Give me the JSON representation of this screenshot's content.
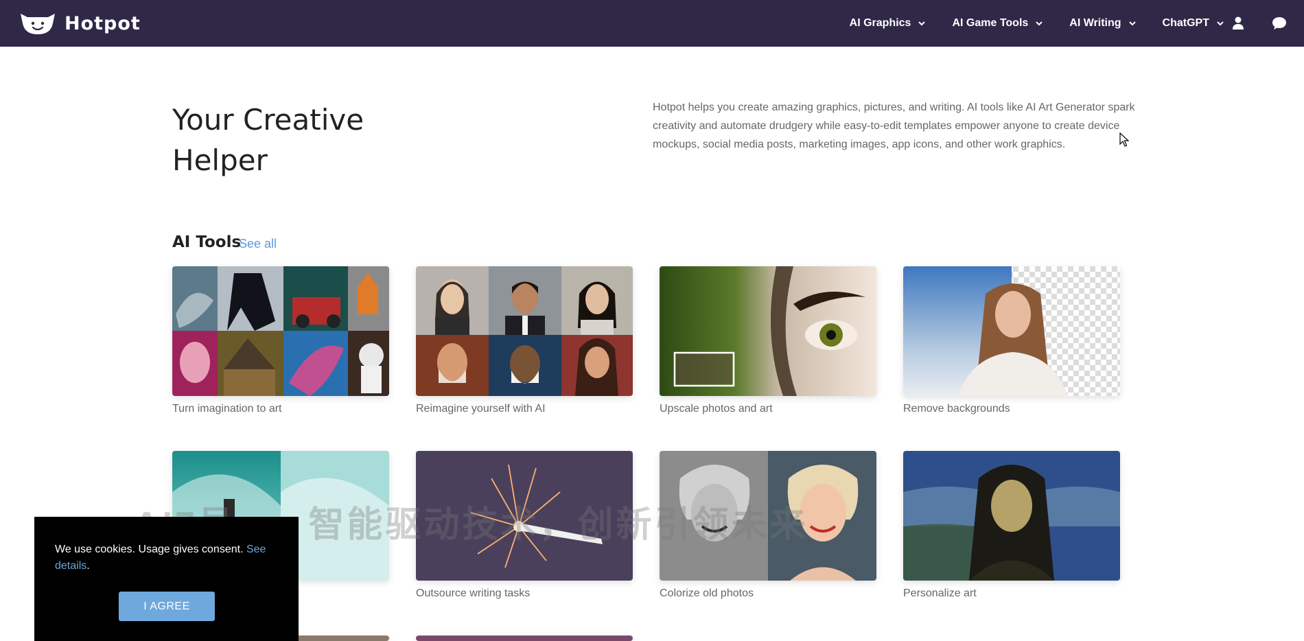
{
  "brand": {
    "name": "Hotpot"
  },
  "nav": {
    "items": [
      {
        "label": "AI Graphics"
      },
      {
        "label": "AI Game Tools"
      },
      {
        "label": "AI Writing"
      },
      {
        "label": "ChatGPT"
      }
    ],
    "icons": [
      "chevron-down-icon",
      "user-icon",
      "chat-bubble-icon"
    ]
  },
  "hero": {
    "title": "Your Creative Helper",
    "description": "Hotpot helps you create amazing graphics, pictures, and writing. AI tools like AI Art Generator spark creativity and automate drudgery while easy-to-edit templates empower anyone to create device mockups, social media posts, marketing images, app icons, and other work graphics."
  },
  "tools": {
    "section_title": "AI Tools",
    "see_all": "See all",
    "cards": [
      {
        "label": "Turn imagination to art"
      },
      {
        "label": "Reimagine yourself with AI"
      },
      {
        "label": "Upscale photos and art"
      },
      {
        "label": "Remove backgrounds"
      },
      {
        "label": ""
      },
      {
        "label": "Outsource writing tasks"
      },
      {
        "label": "Colorize old photos"
      },
      {
        "label": "Personalize art"
      }
    ]
  },
  "watermark": {
    "text": "AI7号.cn 智能驱动技术，创新引领未来"
  },
  "cookie": {
    "text_before": "We use cookies. Usage gives consent.",
    "link": "See details",
    "text_after": ".",
    "button": "I AGREE"
  },
  "colors": {
    "nav_bg": "#2f2847",
    "accent_link": "#5b9bd5",
    "cookie_button": "#6fa8dc"
  }
}
